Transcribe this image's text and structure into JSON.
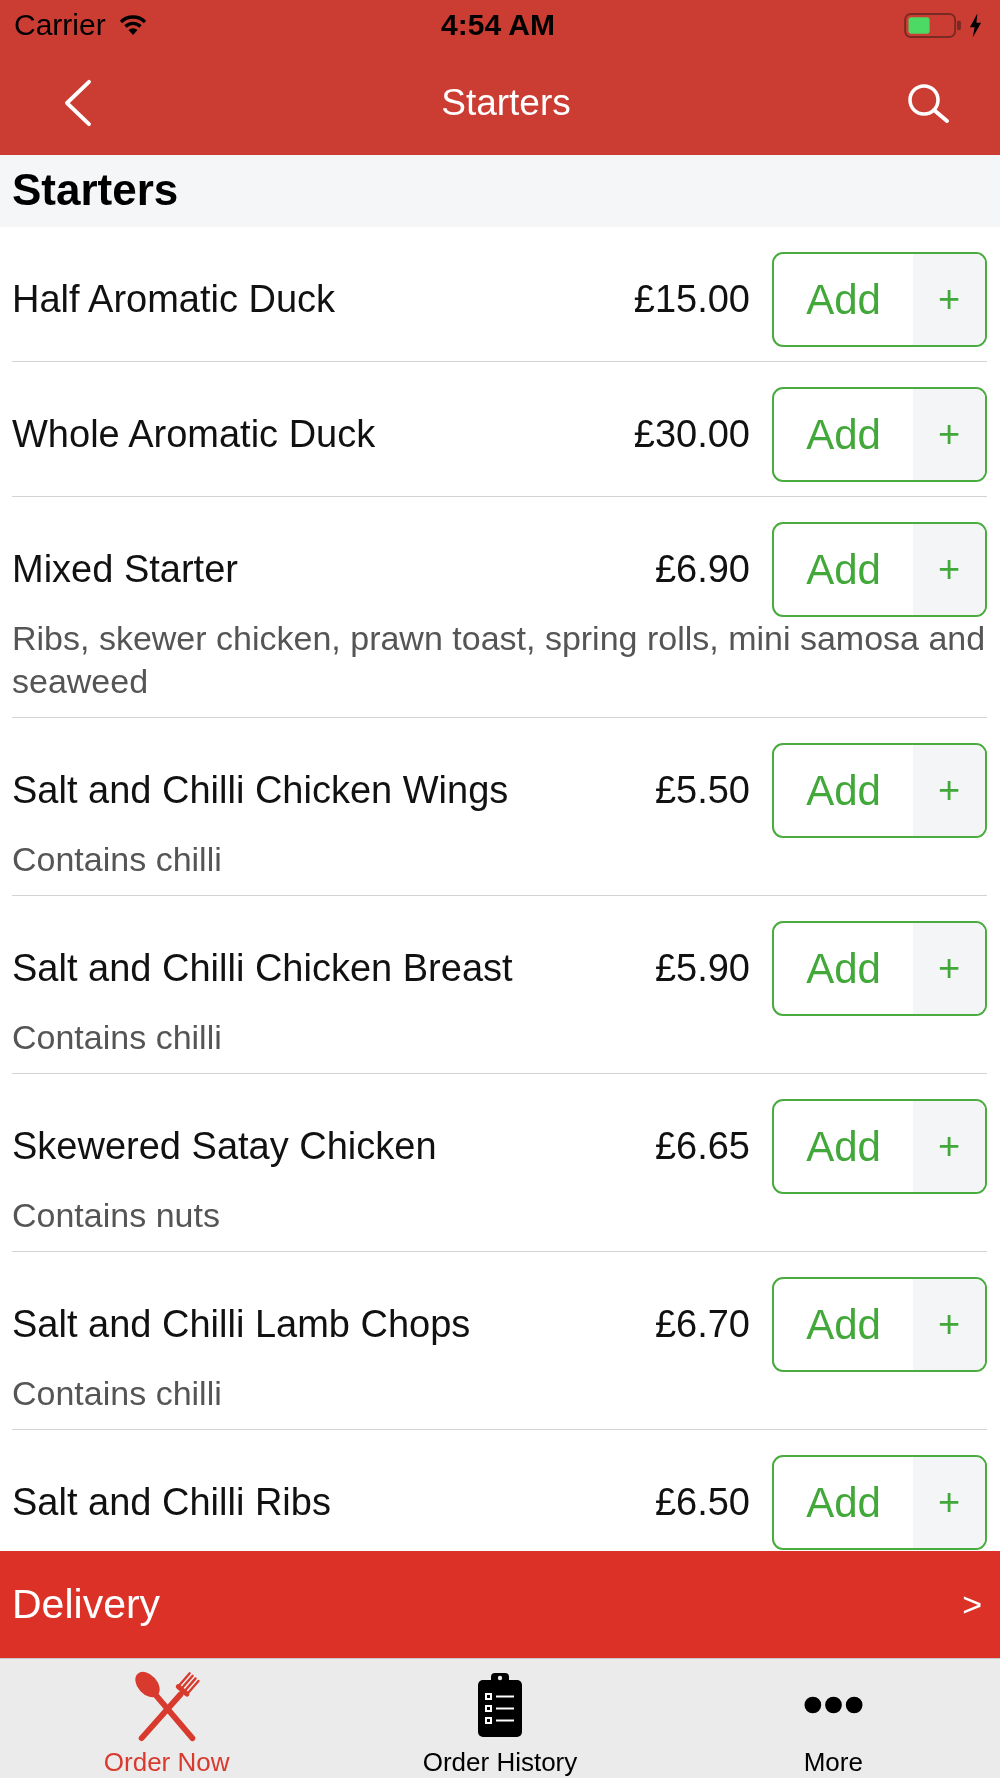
{
  "status_bar": {
    "carrier": "Carrier",
    "time": "4:54 AM"
  },
  "nav_bar": {
    "title": "Starters"
  },
  "section": {
    "title": "Starters",
    "items": [
      {
        "name": "Half Aromatic Duck",
        "price": "£15.00",
        "button_label": "Add",
        "button_symbol": "+"
      },
      {
        "name": "Whole Aromatic Duck",
        "price": "£30.00",
        "button_label": "Add",
        "button_symbol": "+"
      },
      {
        "name": "Mixed Starter",
        "price": "£6.90",
        "description": "Ribs, skewer chicken, prawn toast, spring rolls, mini samosa and seaweed",
        "button_label": "Add",
        "button_symbol": "+"
      },
      {
        "name": "Salt and Chilli Chicken Wings",
        "price": "£5.50",
        "description": "Contains chilli",
        "button_label": "Add",
        "button_symbol": "+"
      },
      {
        "name": "Salt and Chilli Chicken Breast",
        "price": "£5.90",
        "description": "Contains chilli",
        "button_label": "Add",
        "button_symbol": "+"
      },
      {
        "name": "Skewered Satay Chicken",
        "price": "£6.65",
        "description": "Contains nuts",
        "button_label": "Add",
        "button_symbol": "+"
      },
      {
        "name": "Salt and Chilli Lamb Chops",
        "price": "£6.70",
        "description": "Contains chilli",
        "button_label": "Add",
        "button_symbol": "+"
      },
      {
        "name": "Salt and Chilli Ribs",
        "price": "£6.50",
        "button_label": "Add",
        "button_symbol": "+"
      }
    ]
  },
  "delivery_bar": {
    "label": "Delivery",
    "arrow": ">"
  },
  "tab_bar": [
    {
      "kind": "order",
      "label": "Order Now",
      "selected": true
    },
    {
      "kind": "history",
      "label": "Order History",
      "selected": false
    },
    {
      "kind": "more",
      "label": "More",
      "selected": false
    }
  ]
}
